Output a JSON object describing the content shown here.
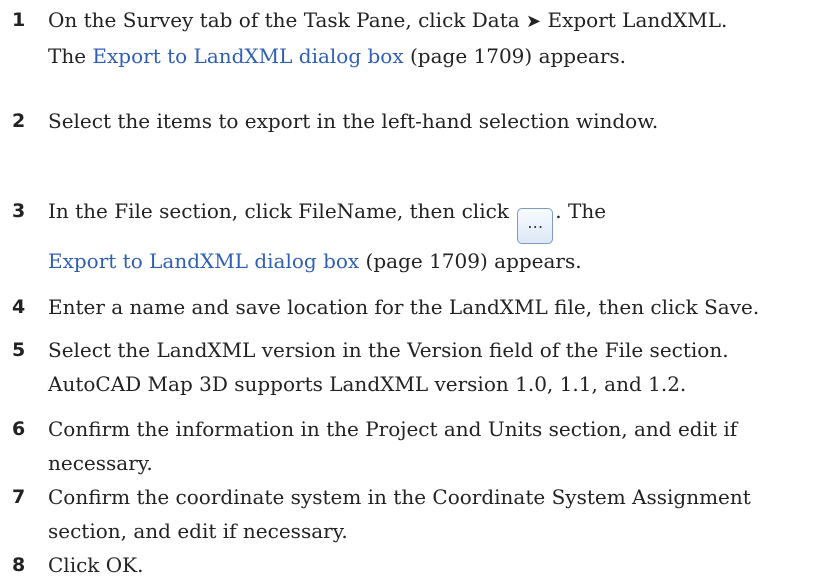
{
  "steps": [
    {
      "num": "1",
      "line1_text": "On the Survey tab of the Task Pane, click Data ",
      "arrow": "➤",
      "line1_text2": " Export LandXML.",
      "line2_prefix": "The ",
      "link": "Export to LandXML dialog box",
      "line2_suffix": " (page 1709) appears."
    },
    {
      "num": "2",
      "text": "Select the items to export in the left-hand selection window."
    },
    {
      "num": "3",
      "line1_prefix": "In the File section, click FileName, then click ",
      "button_icon": "…",
      "line1_suffix": ". The",
      "link": "Export to LandXML dialog box",
      "line2_suffix": " (page 1709) appears."
    },
    {
      "num": "4",
      "text": "Enter a name and save location for the LandXML file, then click Save."
    },
    {
      "num": "5",
      "line1": "Select the LandXML version in the Version field of the File section.",
      "line2": "AutoCAD Map 3D supports LandXML version 1.0, 1.1, and 1.2."
    },
    {
      "num": "6",
      "line1": "Confirm the information in the Project and Units section, and edit if",
      "line2": "necessary."
    },
    {
      "num": "7",
      "line1": "Confirm the coordinate system in the Coordinate System Assignment",
      "line2": "section, and edit if necessary."
    },
    {
      "num": "8",
      "text": "Click OK."
    }
  ],
  "colors": {
    "link": "#2f5fb3",
    "text": "#222222"
  },
  "icons": {
    "ellipsis_button": "ellipsis-button-icon",
    "arrow": "arrow-right-icon"
  }
}
